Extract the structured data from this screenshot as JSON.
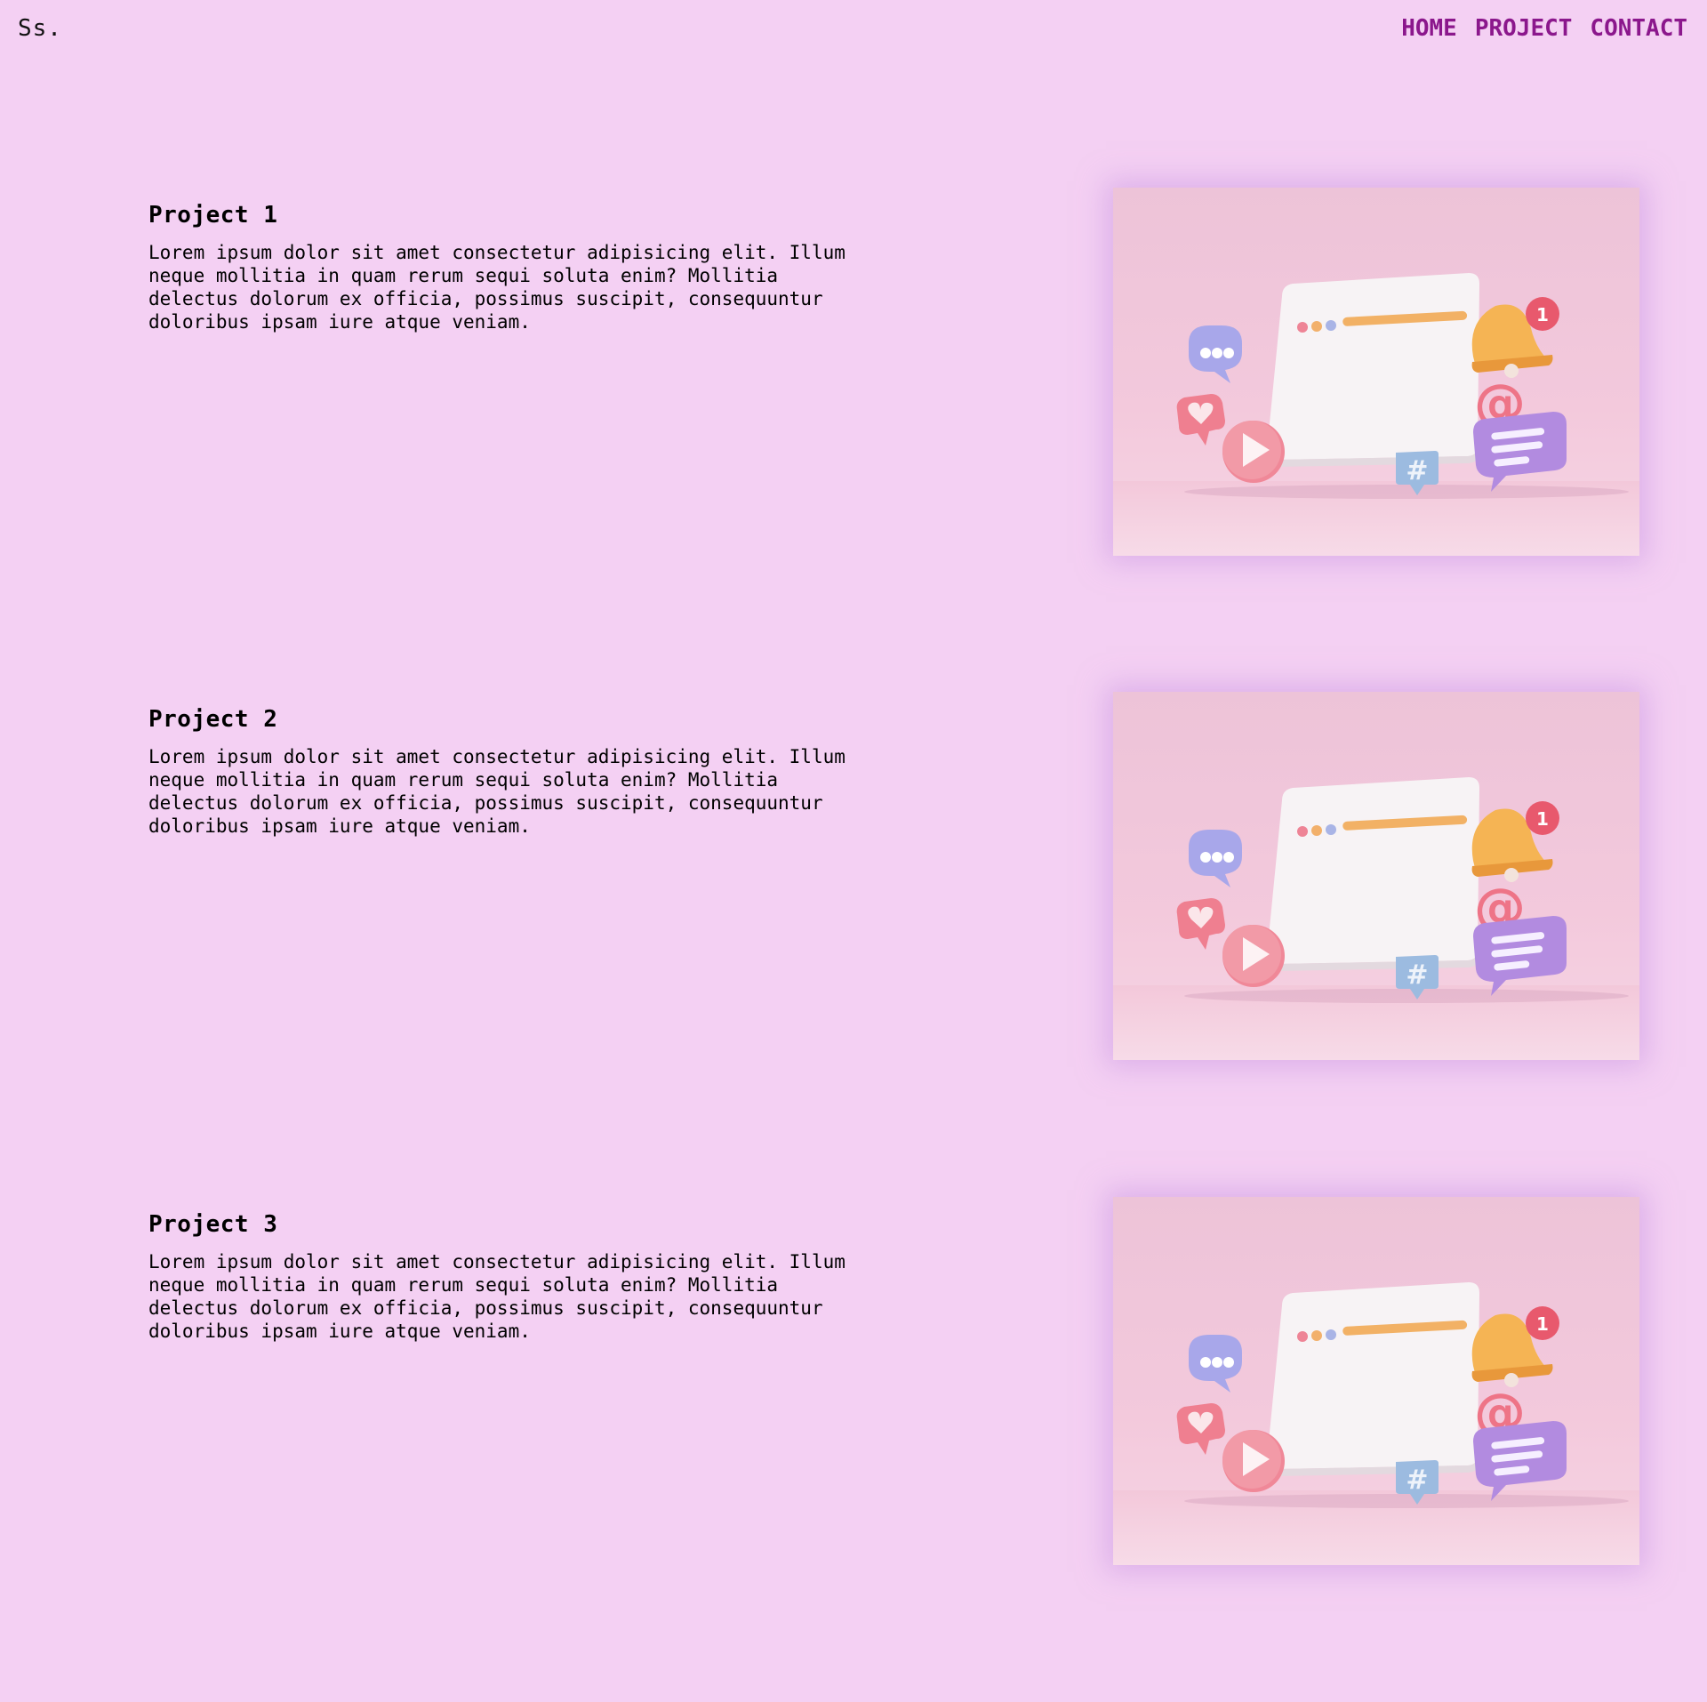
{
  "header": {
    "logo": "Ss.",
    "nav": [
      {
        "label": "HOME"
      },
      {
        "label": "PROJECT"
      },
      {
        "label": "CONTACT"
      }
    ]
  },
  "projects": [
    {
      "title": "Project 1",
      "description": "Lorem ipsum dolor sit amet consectetur adipisicing elit. Illum\nneque mollitia in quam rerum sequi soluta enim? Mollitia\ndelectus dolorum ex officia, possimus suscipit, consequuntur\ndoloribus ipsam iure atque veniam.",
      "image": {
        "code_symbol": "</>",
        "badge": "1",
        "hash": "#",
        "at": "@"
      }
    },
    {
      "title": "Project 2",
      "description": "Lorem ipsum dolor sit amet consectetur adipisicing elit. Illum\nneque mollitia in quam rerum sequi soluta enim? Mollitia\ndelectus dolorum ex officia, possimus suscipit, consequuntur\ndoloribus ipsam iure atque veniam.",
      "image": {
        "code_symbol": "</>",
        "badge": "1",
        "hash": "#",
        "at": "@"
      }
    },
    {
      "title": "Project 3",
      "description": "Lorem ipsum dolor sit amet consectetur adipisicing elit. Illum\nneque mollitia in quam rerum sequi soluta enim? Mollitia\ndelectus dolorum ex officia, possimus suscipit, consequuntur\ndoloribus ipsam iure atque veniam.",
      "image": {
        "code_symbol": "</>",
        "badge": "1",
        "hash": "#",
        "at": "@"
      }
    }
  ],
  "colors": {
    "background": "#f4d0f3",
    "nav_link": "#8b178c"
  }
}
